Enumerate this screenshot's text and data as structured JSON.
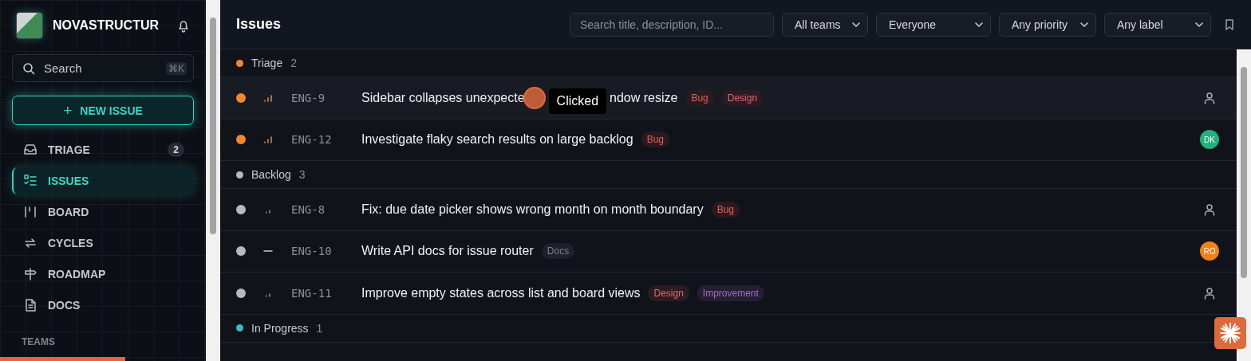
{
  "sidebar": {
    "brand": "NOVASTRUCTUR",
    "search": {
      "placeholder": "Search",
      "shortcut": "⌘K"
    },
    "new_issue": {
      "icon": "+",
      "label": "NEW ISSUE"
    },
    "items": [
      {
        "kind": "inbox",
        "label": "TRIAGE",
        "badge": "2",
        "selected": false
      },
      {
        "kind": "list",
        "label": "ISSUES",
        "selected": true
      },
      {
        "kind": "board",
        "label": "BOARD",
        "selected": false
      },
      {
        "kind": "cycle",
        "label": "CYCLES",
        "selected": false
      },
      {
        "kind": "signpost",
        "label": "ROADMAP",
        "selected": false
      },
      {
        "kind": "doc",
        "label": "DOCS",
        "selected": false
      }
    ],
    "section": "TEAMS"
  },
  "header": {
    "title": "Issues",
    "search": {
      "placeholder": "Search title, description, ID..."
    },
    "filters": [
      {
        "value": "All teams"
      },
      {
        "value": "Everyone"
      },
      {
        "value": "Any priority"
      },
      {
        "value": "Any label"
      }
    ]
  },
  "groups": [
    {
      "name": "Triage",
      "count": "2",
      "color": "#f5862e",
      "issues": [
        {
          "id": "ENG-9",
          "title": "Sidebar collapses unexpecte",
          "title_after_tooltip": "ndow resize",
          "kind": "medium",
          "hovered": true,
          "labels": [
            {
              "text": "Bug",
              "kind": "bug"
            },
            {
              "text": "Design",
              "kind": "design"
            }
          ]
        },
        {
          "id": "ENG-12",
          "title": "Investigate flaky search results on large backlog",
          "kind": "medium",
          "hovered": false,
          "labels": [
            {
              "text": "Bug",
              "kind": "bug"
            }
          ],
          "assignee": {
            "initials": "DK",
            "color": "#22b07d"
          }
        }
      ]
    },
    {
      "name": "Backlog",
      "count": "3",
      "color": "#b8b9c0",
      "issues": [
        {
          "id": "ENG-8",
          "title": "Fix: due date picker shows wrong month on month boundary",
          "kind": "low",
          "hovered": false,
          "labels": [
            {
              "text": "Bug",
              "kind": "bug"
            }
          ]
        },
        {
          "id": "ENG-10",
          "title": "Write API docs for issue router",
          "kind": "none",
          "hovered": false,
          "labels": [
            {
              "text": "Docs",
              "kind": "docs"
            }
          ],
          "assignee": {
            "initials": "RO",
            "color": "#f0801e"
          }
        },
        {
          "id": "ENG-11",
          "title": "Improve empty states across list and board views",
          "kind": "low",
          "hovered": false,
          "labels": [
            {
              "text": "Design",
              "kind": "design"
            },
            {
              "text": "Improvement",
              "kind": "improvement"
            }
          ]
        }
      ]
    },
    {
      "name": "In Progress",
      "count": "1",
      "color": "#3fb8c4"
    }
  ],
  "tooltip": "Clicked"
}
